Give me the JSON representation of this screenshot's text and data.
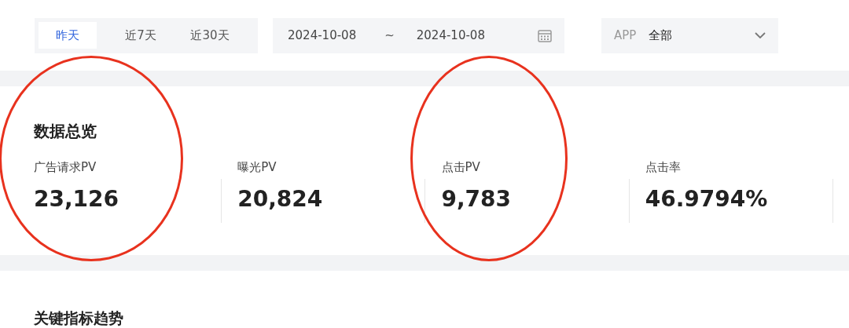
{
  "filters": {
    "tabs": [
      {
        "label": "昨天",
        "selected": true
      },
      {
        "label": "近7天",
        "selected": false
      },
      {
        "label": "近30天",
        "selected": false
      }
    ],
    "date_range": {
      "start": "2024-10-08",
      "separator": "~",
      "end": "2024-10-08"
    },
    "app_select": {
      "label": "APP",
      "value": "全部"
    }
  },
  "overview": {
    "title": "数据总览",
    "stats": [
      {
        "label": "广告请求PV",
        "value": "23,126",
        "circled": true
      },
      {
        "label": "曝光PV",
        "value": "20,824",
        "circled": false
      },
      {
        "label": "点击PV",
        "value": "9,783",
        "circled": true
      },
      {
        "label": "点击率",
        "value": "46.9794%",
        "circled": false
      }
    ]
  },
  "trend": {
    "title": "关键指标趋势"
  }
}
